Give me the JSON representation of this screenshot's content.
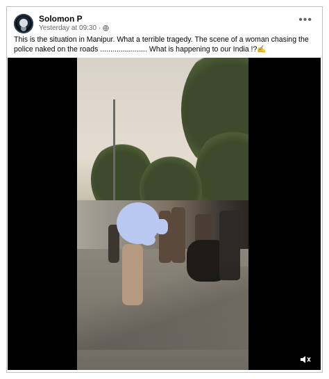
{
  "post": {
    "author": "Solomon P",
    "timestamp": "Yesterday at 09:30",
    "separator": "·",
    "privacy_icon": "globe-icon",
    "more_label": "•••",
    "caption": "This is the situation in Manipur.  What a terrible tragedy.  The scene of a woman chasing the police naked on the roads ....................... What is happening to our India !?✍"
  },
  "video": {
    "mute_icon": "speaker-muted-icon"
  },
  "colors": {
    "author_text": "#050505",
    "meta_text": "#65676b",
    "video_background": "#000000",
    "blur_overlay": "#b9c8f0"
  }
}
